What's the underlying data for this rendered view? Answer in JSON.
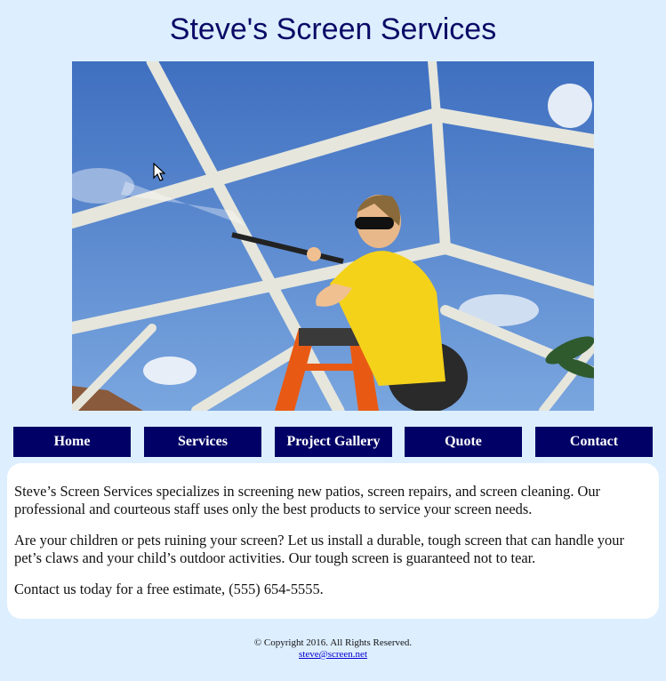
{
  "header": {
    "title": "Steve's Screen Services"
  },
  "hero": {
    "image": "woman pressure washing pool screen enclosure on orange ladder"
  },
  "nav": {
    "items": [
      {
        "label": "Home"
      },
      {
        "label": "Services"
      },
      {
        "label": "Project Gallery"
      },
      {
        "label": "Quote"
      },
      {
        "label": "Contact"
      }
    ]
  },
  "main": {
    "paragraphs": [
      "Steve’s Screen Services specializes in screening new patios, screen repairs, and screen cleaning. Our professional and courteous staff uses only the best products to service your screen needs.",
      "Are your children or pets ruining your screen? Let us install a durable, tough screen that can handle your pet’s claws and your child’s outdoor activities. Our tough screen is guaranteed not to tear.",
      "Contact us today for a free estimate, (555) 654-5555."
    ]
  },
  "footer": {
    "copyright": "© Copyright 2016. All Rights Reserved.",
    "email": "steve@screen.net"
  },
  "colors": {
    "background": "#ddeeff",
    "title": "#0a0a66",
    "nav_bg": "#000066",
    "nav_text": "#ffffff",
    "link": "#0000cc"
  }
}
